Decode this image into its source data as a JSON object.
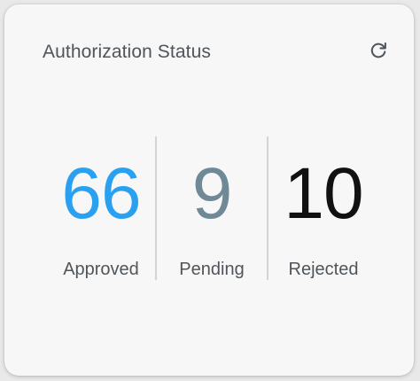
{
  "card": {
    "title": "Authorization Status",
    "refresh_icon": "refresh-icon"
  },
  "stats": {
    "approved": {
      "value": "66",
      "label": "Approved",
      "color": "#2aa0f0"
    },
    "pending": {
      "value": "9",
      "label": "Pending",
      "color": "#6f8a96"
    },
    "rejected": {
      "value": "10",
      "label": "Rejected",
      "color": "#111111"
    }
  }
}
